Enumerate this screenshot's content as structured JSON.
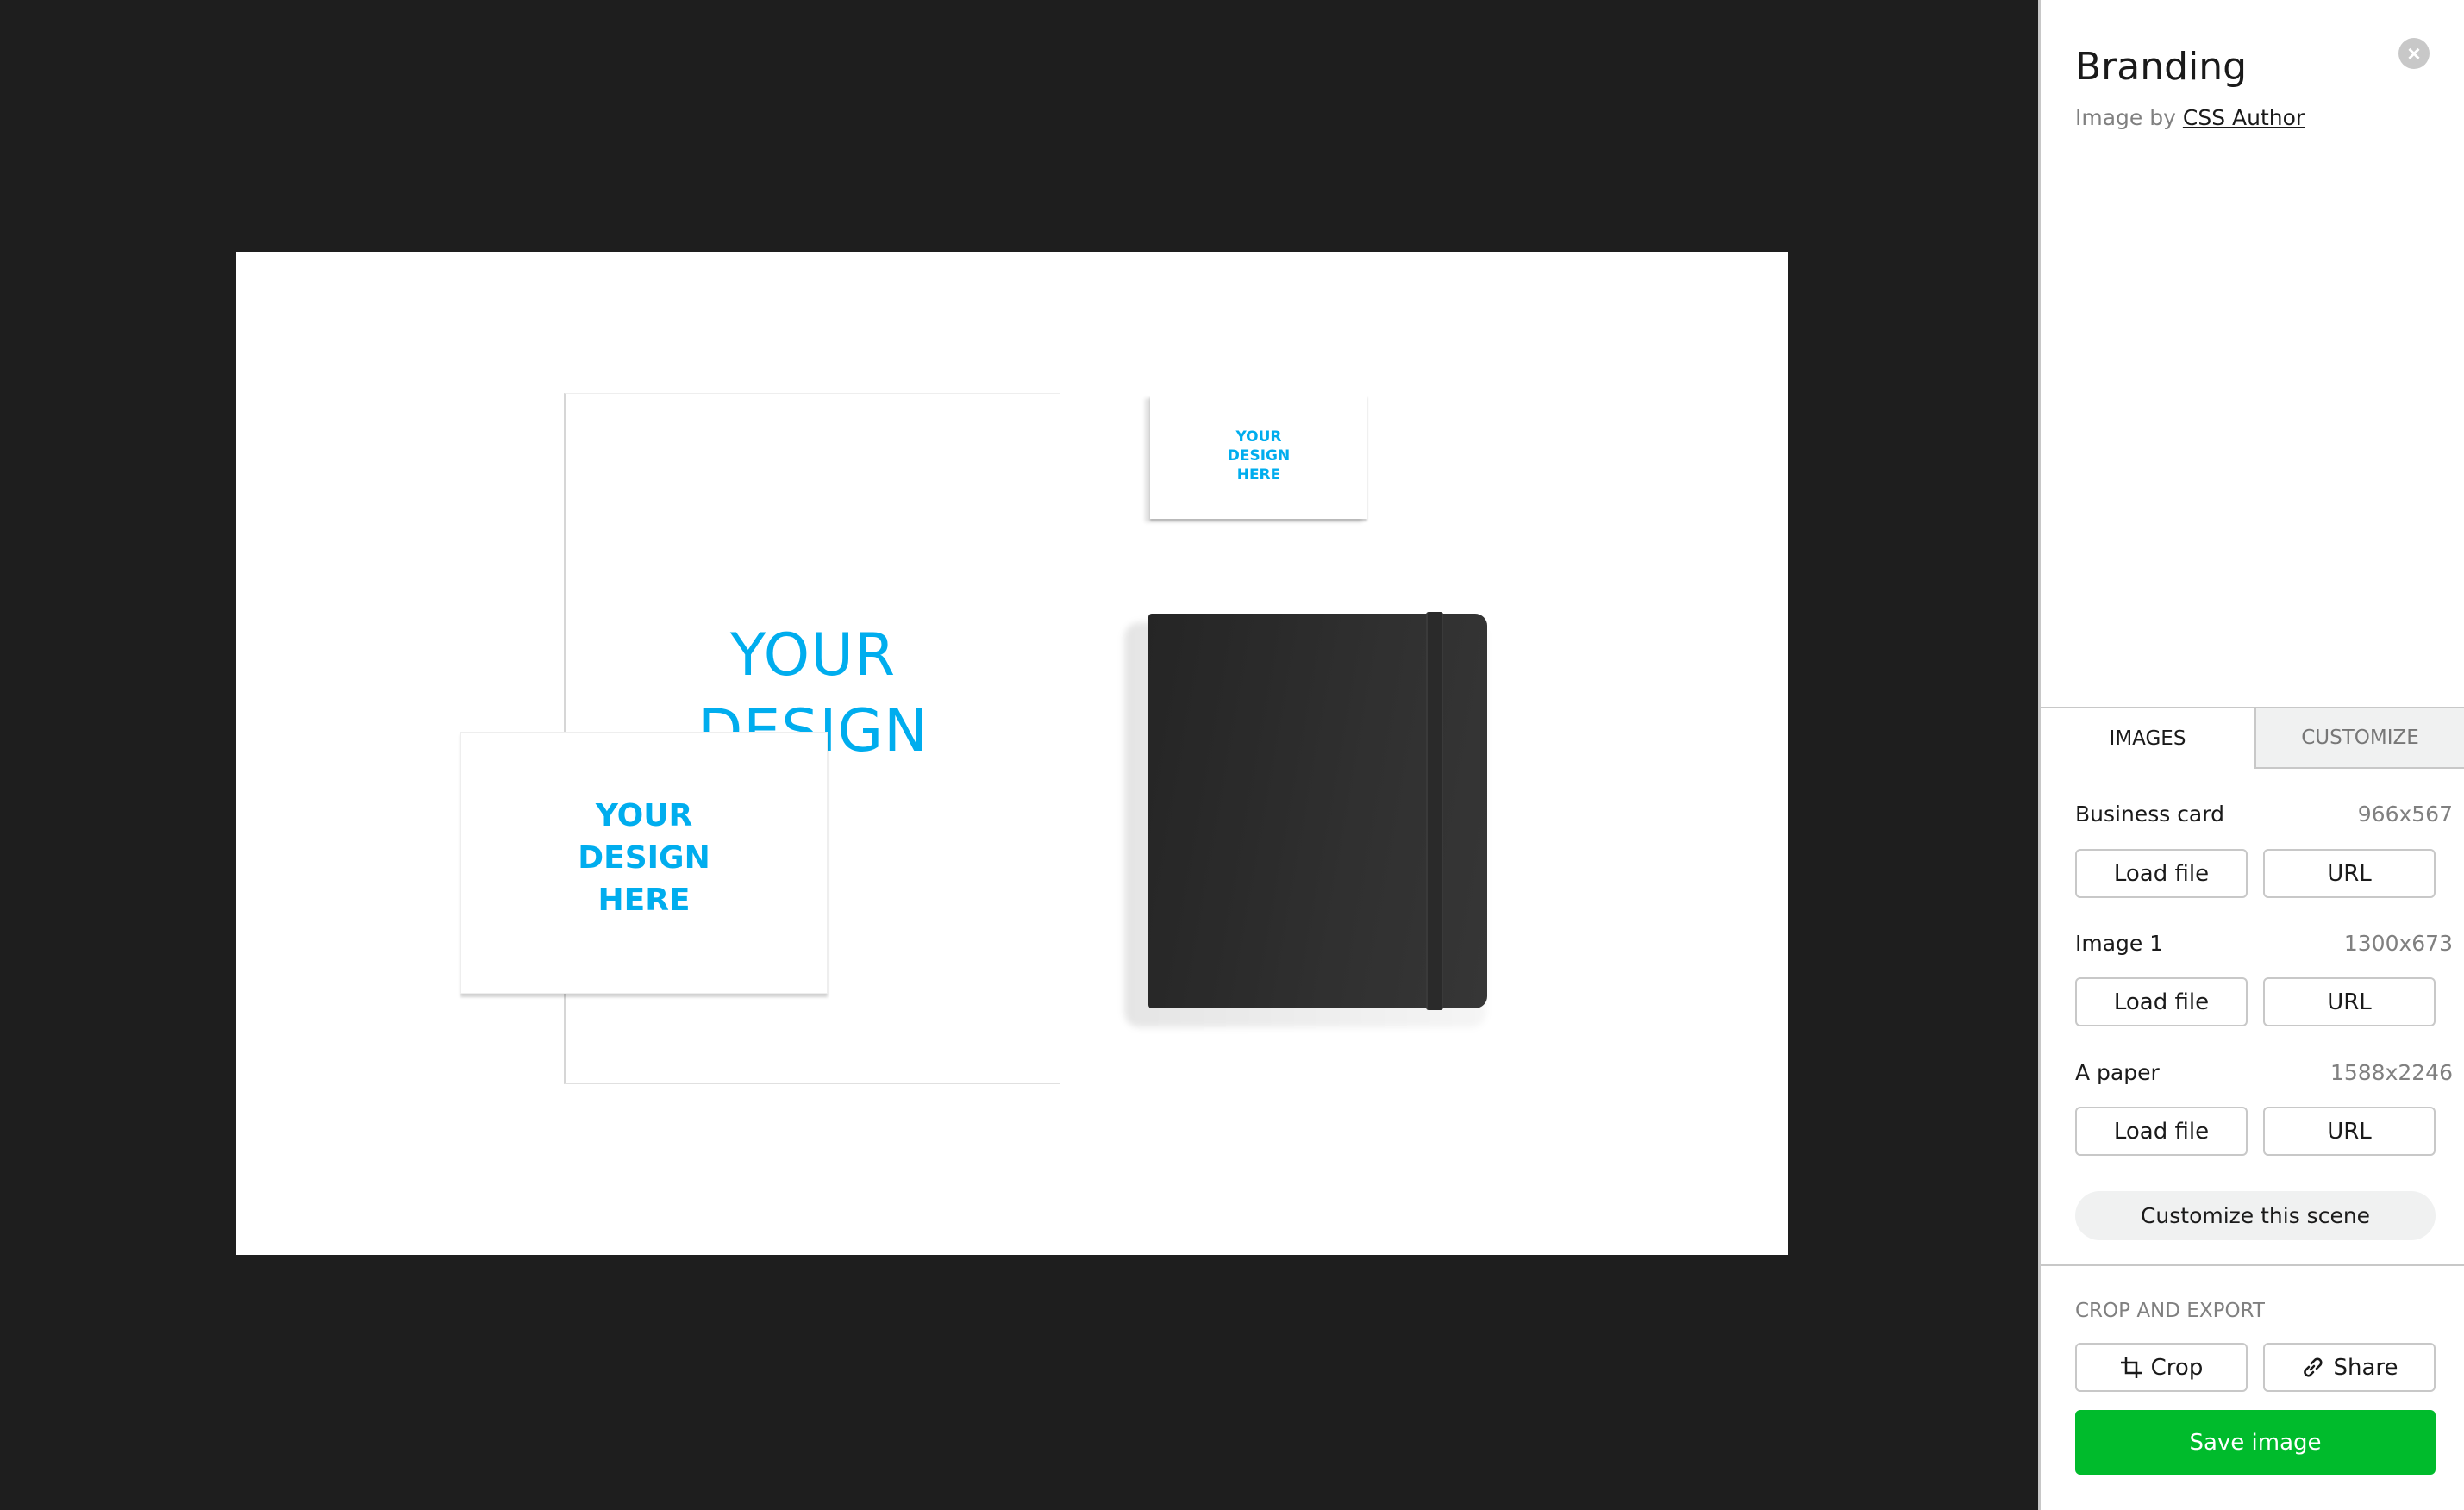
{
  "canvas": {
    "paper_text": "YOUR DESIGN",
    "business_card_text": [
      "YOUR",
      "DESIGN",
      "HERE"
    ],
    "small_card_text": [
      "YOUR",
      "DESIGN",
      "HERE"
    ],
    "accent_color": "#00adee"
  },
  "panel": {
    "title": "Branding",
    "byline_prefix": "Image by",
    "author_link": "CSS Author",
    "close_icon": "close-icon",
    "tabs": [
      {
        "label": "IMAGES",
        "active": true
      },
      {
        "label": "CUSTOMIZE",
        "active": false
      }
    ],
    "images": [
      {
        "label": "Business card",
        "size": "966x567",
        "load_label": "Load file",
        "url_label": "URL"
      },
      {
        "label": "Image 1",
        "size": "1300x673",
        "load_label": "Load file",
        "url_label": "URL"
      },
      {
        "label": "A paper",
        "size": "1588x2246",
        "load_label": "Load file",
        "url_label": "URL"
      }
    ],
    "customize_scene_label": "Customize this scene",
    "crop_section_title": "CROP AND EXPORT",
    "crop_label": "Crop",
    "share_label": "Share",
    "save_label": "Save image",
    "save_color": "#00bb2c"
  }
}
